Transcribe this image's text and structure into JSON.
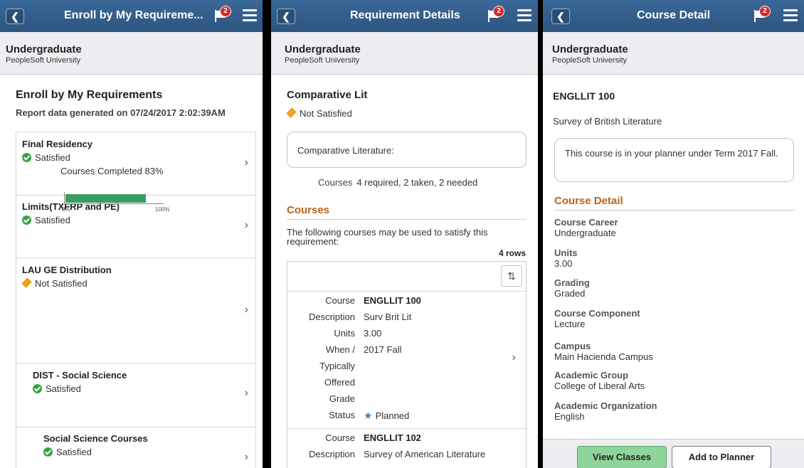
{
  "common": {
    "career": "Undergraduate",
    "institution": "PeopleSoft University",
    "notification_count": "2"
  },
  "panel1": {
    "header_title": "Enroll by My Requireme...",
    "heading": "Enroll by My Requirements",
    "report_line": "Report data generated on 07/24/2017 2:02:39AM",
    "items": [
      {
        "name": "Final Residency",
        "status": "Satisfied"
      },
      {
        "name": "Limits(TXFRP and PE)",
        "status": "Satisfied"
      },
      {
        "name": "LAU GE Distribution",
        "status": "Not Satisfied"
      },
      {
        "name": "DIST - Social Science",
        "status": "Satisfied"
      },
      {
        "name": "Social Science Courses",
        "status": "Satisfied"
      }
    ],
    "progress": {
      "label": "Courses Completed 83%",
      "value": 0.83,
      "min_label": "0%",
      "max_label": "100%"
    }
  },
  "panel2": {
    "header_title": "Requirement Details",
    "heading": "Comparative Lit",
    "status": "Not Satisfied",
    "description": "Comparative Literature:",
    "courses_label": "Courses",
    "courses_value": "4 required, 2 taken, 2 needed",
    "section_title": "Courses",
    "following_text": "The following courses may be used to satisfy this requirement:",
    "rows_count": "4 rows",
    "field_labels": {
      "course": "Course",
      "description": "Description",
      "units": "Units",
      "when1": "When /",
      "when2": "Typically",
      "when3": "Offered",
      "grade": "Grade",
      "status": "Status"
    },
    "rows": [
      {
        "course": "ENGLLIT 100",
        "description": "Surv Brit Lit",
        "units": "3.00",
        "when": "2017 Fall",
        "grade": "",
        "status": "Planned"
      },
      {
        "course": "ENGLLIT 102",
        "description": "Survey of American Literature"
      }
    ]
  },
  "panel3": {
    "header_title": "Course Detail",
    "course_code": "ENGLLIT 100",
    "course_title": "Survey of British Literature",
    "planner_note": "This course is in your planner under Term 2017 Fall.",
    "section_title": "Course Detail",
    "details": [
      {
        "label": "Course Career",
        "value": "Undergraduate"
      },
      {
        "label": "Units",
        "value": "3.00"
      },
      {
        "label": "Grading",
        "value": "Graded"
      },
      {
        "label": "Course Component",
        "value": "Lecture"
      },
      {
        "label": "Campus",
        "value": "Main Hacienda Campus"
      },
      {
        "label": "Academic Group",
        "value": "College of Liberal Arts"
      },
      {
        "label": "Academic Organization",
        "value": "English"
      }
    ],
    "view_classes_label": "View Classes",
    "add_to_planner_label": "Add to Planner"
  },
  "colors": {
    "header": "#2d5580",
    "satisfied": "#3aa146",
    "not_satisfied": "#f0a021",
    "section_heading": "#b5651d",
    "progress_fill": "#3a9d61",
    "primary_button": "#8fd49a"
  },
  "icons": {
    "back": "chevron-left-icon",
    "notifications": "flag-icon",
    "menu": "hamburger-menu-icon",
    "satisfied": "check-circle-icon",
    "not_satisfied": "diamond-icon",
    "row_nav": "chevron-right-icon",
    "sort": "sort-icon",
    "planned": "star-icon"
  }
}
